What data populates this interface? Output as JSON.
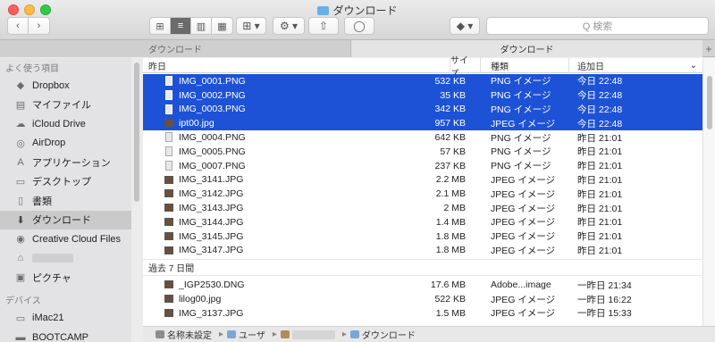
{
  "window": {
    "title": "ダウンロード"
  },
  "toolbar": {
    "back_label": "‹",
    "forward_label": "›",
    "view_icons": [
      "⊞",
      "≡",
      "▥",
      "▦"
    ],
    "arrange_label": "⊞ ▾",
    "action_label": "⚙ ▾",
    "share_label": "⇧",
    "tag_label": "◯",
    "dropbox_label": "◆ ▾",
    "search_placeholder": "Q 検索"
  },
  "tabs": [
    {
      "label": "ダウンロード"
    },
    {
      "label": "ダウンロード"
    }
  ],
  "tab_add_label": "+",
  "sidebar": {
    "favorites_header": "よく使う項目",
    "items": [
      {
        "label": "Dropbox",
        "icon": "dropbox-icon",
        "glyph": "◆"
      },
      {
        "label": "マイファイル",
        "icon": "all-files-icon",
        "glyph": "▤"
      },
      {
        "label": "iCloud Drive",
        "icon": "cloud-icon",
        "glyph": "☁"
      },
      {
        "label": "AirDrop",
        "icon": "airdrop-icon",
        "glyph": "◎"
      },
      {
        "label": "アプリケーション",
        "icon": "applications-icon",
        "glyph": "A"
      },
      {
        "label": "デスクトップ",
        "icon": "desktop-icon",
        "glyph": "▭"
      },
      {
        "label": "書類",
        "icon": "documents-icon",
        "glyph": "▯"
      },
      {
        "label": "ダウンロード",
        "icon": "downloads-icon",
        "glyph": "⬇"
      },
      {
        "label": "Creative Cloud Files",
        "icon": "creative-cloud-icon",
        "glyph": "◉"
      },
      {
        "label": "",
        "icon": "home-icon",
        "glyph": "⌂"
      },
      {
        "label": "ピクチャ",
        "icon": "pictures-icon",
        "glyph": "▣"
      }
    ],
    "devices_header": "デバイス",
    "devices": [
      {
        "label": "iMac21",
        "icon": "computer-icon",
        "glyph": "▭"
      },
      {
        "label": "BOOTCAMP",
        "icon": "disk-icon",
        "glyph": "▬"
      }
    ]
  },
  "columns": {
    "name": "昨日",
    "size": "サイズ",
    "kind": "種類",
    "date": "追加日",
    "sort_glyph": "⌄"
  },
  "groups": [
    {
      "rows": [
        {
          "name": "IMG_0001.PNG",
          "size": "532 KB",
          "kind": "PNG イメージ",
          "date": "今日 22:48",
          "selected": true,
          "icon": "png"
        },
        {
          "name": "IMG_0002.PNG",
          "size": "35 KB",
          "kind": "PNG イメージ",
          "date": "今日 22:48",
          "selected": true,
          "icon": "png"
        },
        {
          "name": "IMG_0003.PNG",
          "size": "342 KB",
          "kind": "PNG イメージ",
          "date": "今日 22:48",
          "selected": true,
          "icon": "png"
        },
        {
          "name": "ipt00.jpg",
          "size": "957 KB",
          "kind": "JPEG イメージ",
          "date": "今日 22:48",
          "selected": true,
          "icon": "photo"
        },
        {
          "name": "IMG_0004.PNG",
          "size": "642 KB",
          "kind": "PNG イメージ",
          "date": "昨日 21:01",
          "selected": false,
          "icon": "png"
        },
        {
          "name": "IMG_0005.PNG",
          "size": "57 KB",
          "kind": "PNG イメージ",
          "date": "昨日 21:01",
          "selected": false,
          "icon": "png"
        },
        {
          "name": "IMG_0007.PNG",
          "size": "237 KB",
          "kind": "PNG イメージ",
          "date": "昨日 21:01",
          "selected": false,
          "icon": "png"
        },
        {
          "name": "IMG_3141.JPG",
          "size": "2.2 MB",
          "kind": "JPEG イメージ",
          "date": "昨日 21:01",
          "selected": false,
          "icon": "photo"
        },
        {
          "name": "IMG_3142.JPG",
          "size": "2.1 MB",
          "kind": "JPEG イメージ",
          "date": "昨日 21:01",
          "selected": false,
          "icon": "photo"
        },
        {
          "name": "IMG_3143.JPG",
          "size": "2 MB",
          "kind": "JPEG イメージ",
          "date": "昨日 21:01",
          "selected": false,
          "icon": "photo"
        },
        {
          "name": "IMG_3144.JPG",
          "size": "1.4 MB",
          "kind": "JPEG イメージ",
          "date": "昨日 21:01",
          "selected": false,
          "icon": "photo"
        },
        {
          "name": "IMG_3145.JPG",
          "size": "1.8 MB",
          "kind": "JPEG イメージ",
          "date": "昨日 21:01",
          "selected": false,
          "icon": "photo"
        },
        {
          "name": "IMG_3147.JPG",
          "size": "1.8 MB",
          "kind": "JPEG イメージ",
          "date": "昨日 21:01",
          "selected": false,
          "icon": "photo"
        }
      ]
    },
    {
      "label": "過去 7 日間",
      "rows": [
        {
          "name": "_IGP2530.DNG",
          "size": "17.6 MB",
          "kind": "Adobe...image",
          "date": "一昨日 21:34",
          "selected": false,
          "icon": "photo"
        },
        {
          "name": "lilog00.jpg",
          "size": "522 KB",
          "kind": "JPEG イメージ",
          "date": "一昨日 16:22",
          "selected": false,
          "icon": "photo"
        },
        {
          "name": "IMG_3137.JPG",
          "size": "1.5 MB",
          "kind": "JPEG イメージ",
          "date": "一昨日 15:33",
          "selected": false,
          "icon": "photo"
        }
      ]
    }
  ],
  "pathbar": [
    {
      "label": "名称未設定",
      "icon": "hd"
    },
    {
      "label": "ユーザ",
      "icon": "folder"
    },
    {
      "label": "",
      "icon": "home"
    },
    {
      "label": "ダウンロード",
      "icon": "folder"
    }
  ],
  "pathbar_sep": "▸"
}
